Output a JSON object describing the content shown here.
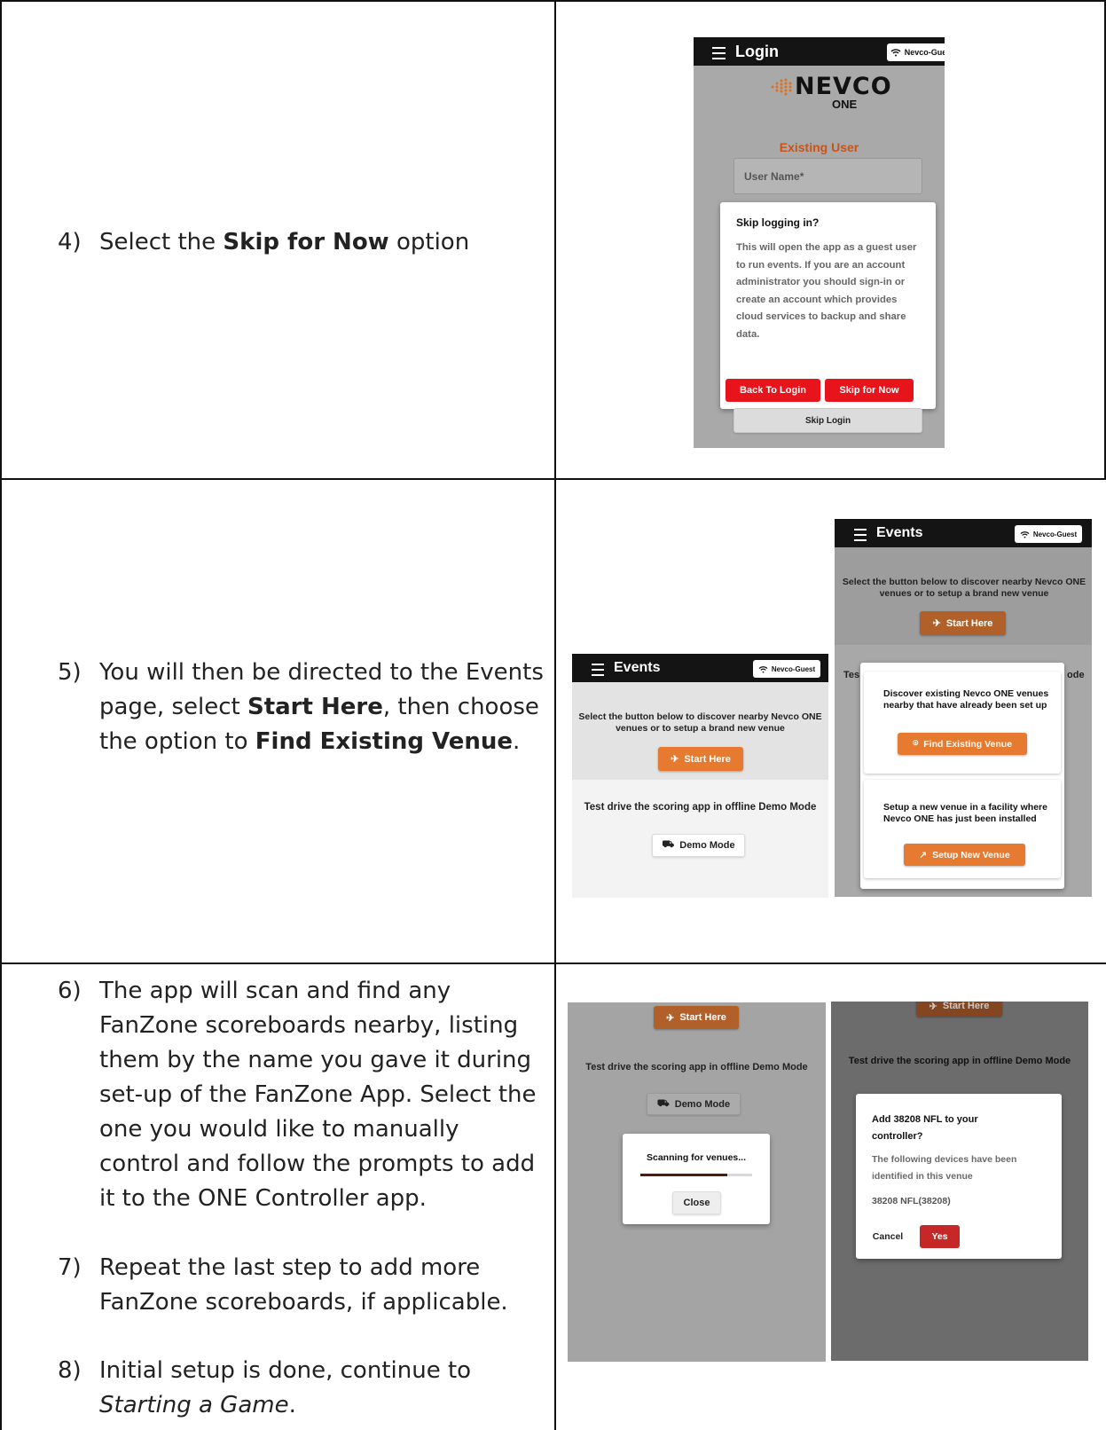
{
  "steps": {
    "s4": {
      "num": "4)",
      "pre": "Select the ",
      "bold": "Skip for Now",
      "post": " option"
    },
    "s5": {
      "num": "5)",
      "pre": "You will then be directed to the Events page, select ",
      "bold1": "Start Here",
      "mid": ", then choose the option to ",
      "bold2": "Find Existing Venue",
      "post": "."
    },
    "s6": {
      "num": "6)",
      "text": "The app will scan and find any FanZone scoreboards nearby, listing them by the name you gave it during set-up of the FanZone App. Select the one you would like to manually control and follow the prompts to add it to the ONE Controller app."
    },
    "s7": {
      "num": "7)",
      "text": "Repeat the last step to add more FanZone scoreboards, if applicable."
    },
    "s8": {
      "num": "8)",
      "pre": "Initial setup is done, continue to ",
      "italic": "Starting a Game",
      "post": "."
    }
  },
  "login_screen": {
    "title": "Login",
    "wifi": "Nevco-Guest",
    "logo_main": "NEVCO",
    "logo_sub": "ONE",
    "section": "Existing User",
    "username_placeholder": "User Name*",
    "dialog_title": "Skip logging in?",
    "dialog_body": "This will open the app as a guest user to run events. If you are an account administrator you should sign-in or create an account which provides cloud services to backup and share data.",
    "back_btn": "Back To Login",
    "skip_btn": "Skip for Now",
    "skip_login": "Skip Login"
  },
  "events_screen": {
    "title": "Events",
    "wifi": "Nevco-Guest",
    "intro": "Select the button below to discover nearby Nevco ONE venues or to setup a brand new venue",
    "start_here": "Start Here",
    "demo_text": "Test drive the scoring app in offline Demo Mode",
    "demo_btn": "Demo Mode"
  },
  "events_popup": {
    "title": "Events",
    "wifi": "Nevco-Guest",
    "intro": "Select the button below to discover nearby Nevco ONE venues or to setup a brand new venue",
    "start_here": "Start Here",
    "bg_left": "Tes",
    "bg_right": "ode",
    "find_text": "Discover existing Nevco ONE venues nearby that have already been set up",
    "find_btn": "Find Existing Venue",
    "setup_text": "Setup a new venue in a facility where Nevco ONE has just been installed",
    "setup_btn": "Setup New Venue"
  },
  "scan_screen": {
    "start_here": "Start Here",
    "demo_text": "Test drive the scoring app in offline Demo Mode",
    "demo_btn": "Demo Mode",
    "scanning": "Scanning for venues...",
    "progress": 0.78,
    "close_btn": "Close"
  },
  "add_screen": {
    "start_here": "Start Here",
    "demo_text": "Test drive the scoring app in offline Demo Mode",
    "dialog_title": "Add 38208 NFL to your controller?",
    "dialog_body": "The following devices have been identified in this venue",
    "device": "38208 NFL(38208)",
    "cancel_btn": "Cancel",
    "yes_btn": "Yes"
  },
  "colors": {
    "orange": "#e57a30",
    "red": "#e8141b",
    "dark_red": "#c62828",
    "appbar": "#141414",
    "logo_orange": "#e0701e"
  }
}
